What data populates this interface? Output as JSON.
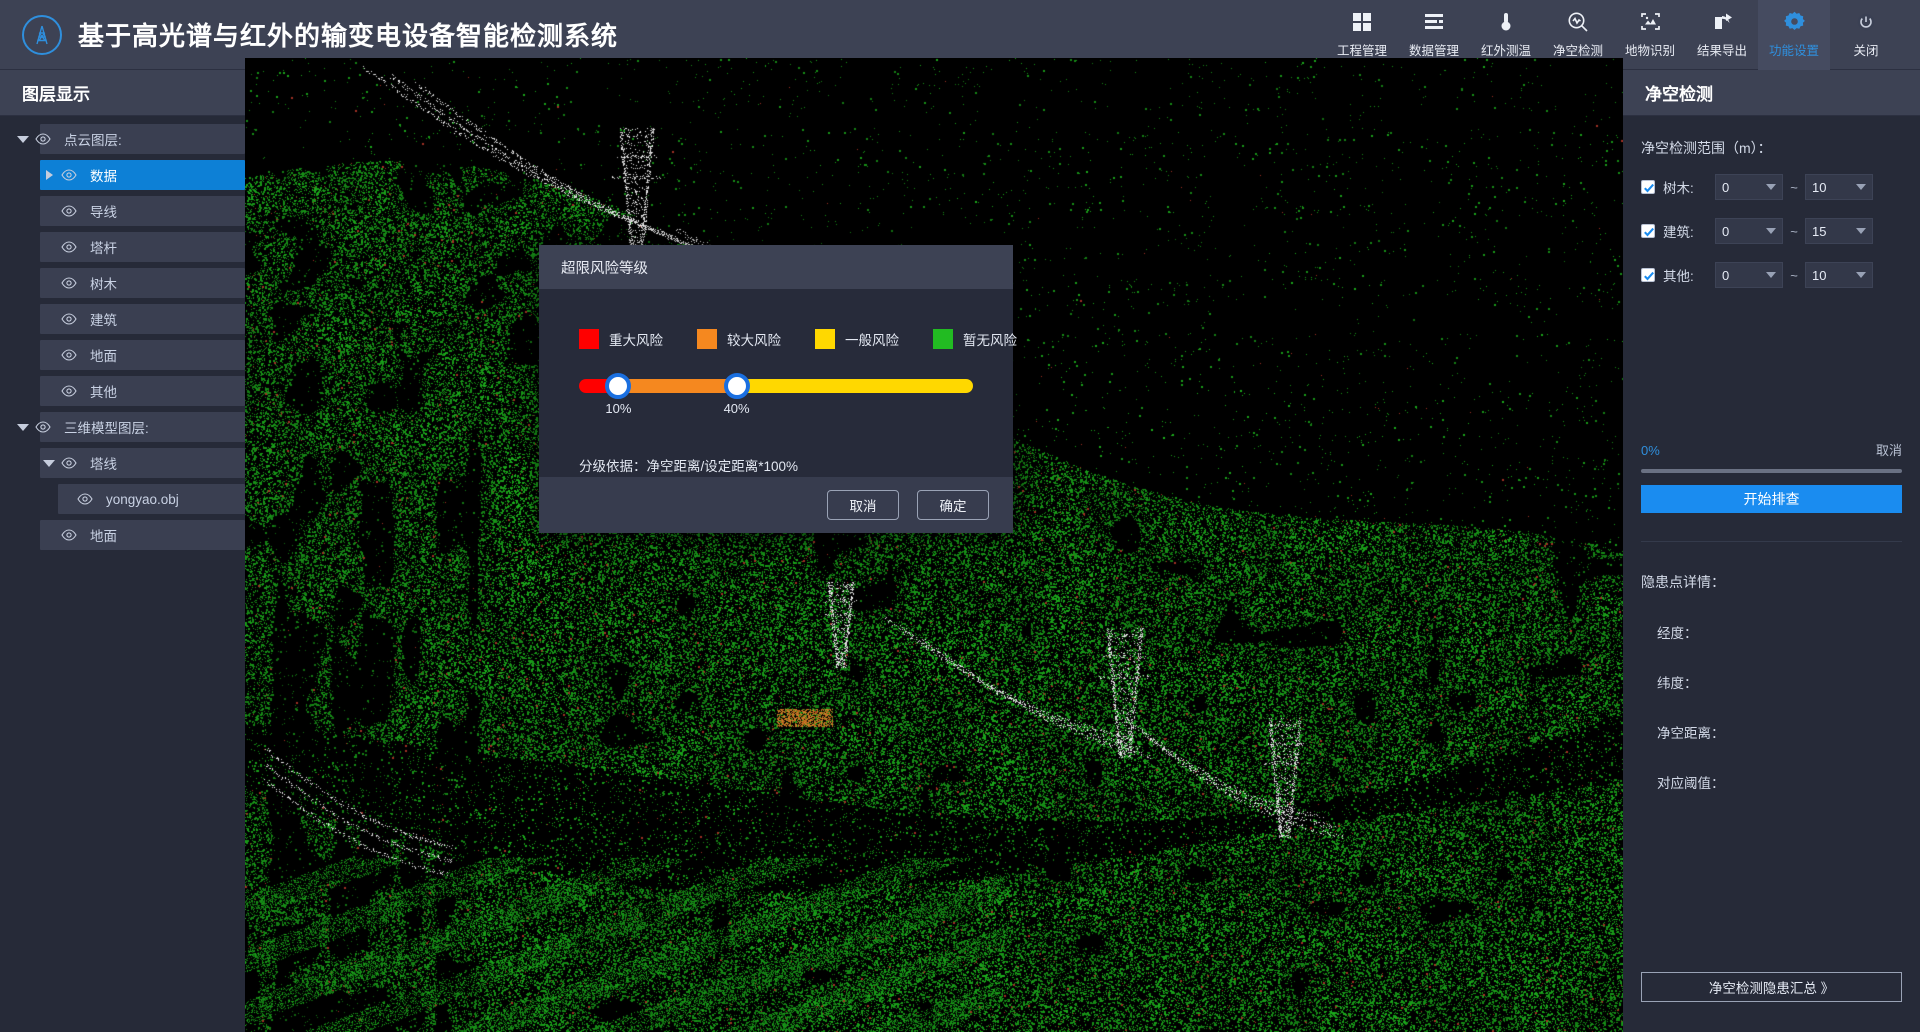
{
  "header": {
    "title": "基于高光谱与红外的输变电设备智能检测系统",
    "logo_icon": "transmission-tower-icon",
    "nav": [
      {
        "label": "工程管理",
        "icon": "grid-icon",
        "active": false
      },
      {
        "label": "数据管理",
        "icon": "database-icon",
        "active": false
      },
      {
        "label": "红外测温",
        "icon": "thermometer-icon",
        "active": false
      },
      {
        "label": "净空检测",
        "icon": "search-wave-icon",
        "active": false
      },
      {
        "label": "地物识别",
        "icon": "image-scan-icon",
        "active": false
      },
      {
        "label": "结果导出",
        "icon": "export-icon",
        "active": false
      },
      {
        "label": "功能设置",
        "icon": "gear-icon",
        "active": true
      },
      {
        "label": "关闭",
        "icon": "power-icon",
        "active": false
      }
    ]
  },
  "left_panel": {
    "title": "图层显示",
    "tree": [
      {
        "label": "点云图层:",
        "depth": 0,
        "caret": "down",
        "eye": true,
        "selected": false
      },
      {
        "label": "数据",
        "depth": 1,
        "caret": "right",
        "eye": true,
        "selected": true
      },
      {
        "label": "导线",
        "depth": 1,
        "caret": "none",
        "eye": true,
        "selected": false
      },
      {
        "label": "塔杆",
        "depth": 1,
        "caret": "none",
        "eye": true,
        "selected": false
      },
      {
        "label": "树木",
        "depth": 1,
        "caret": "none",
        "eye": true,
        "selected": false
      },
      {
        "label": "建筑",
        "depth": 1,
        "caret": "none",
        "eye": true,
        "selected": false
      },
      {
        "label": "地面",
        "depth": 1,
        "caret": "none",
        "eye": true,
        "selected": false
      },
      {
        "label": "其他",
        "depth": 1,
        "caret": "none",
        "eye": true,
        "selected": false
      },
      {
        "label": "三维模型图层:",
        "depth": 0,
        "caret": "down",
        "eye": true,
        "selected": false
      },
      {
        "label": "塔线",
        "depth": 1,
        "caret": "down",
        "eye": true,
        "selected": false
      },
      {
        "label": "yongyao.obj",
        "depth": 2,
        "caret": "none",
        "eye": true,
        "selected": false
      },
      {
        "label": "地面",
        "depth": 1,
        "caret": "none",
        "eye": true,
        "selected": false
      }
    ]
  },
  "right_panel": {
    "title": "净空检测",
    "range_title": "净空检测范围（m）：",
    "ranges": [
      {
        "label": "树木:",
        "checked": true,
        "min": "0",
        "max": "10"
      },
      {
        "label": "建筑:",
        "checked": true,
        "min": "0",
        "max": "15"
      },
      {
        "label": "其他:",
        "checked": true,
        "min": "0",
        "max": "10"
      }
    ],
    "tilde": "~",
    "progress_percent": "0%",
    "progress_value": 0,
    "cancel_label": "取消",
    "start_label": "开始排查",
    "detail_title": "隐患点详情：",
    "details": [
      {
        "label": "经度：",
        "value": ""
      },
      {
        "label": "纬度：",
        "value": ""
      },
      {
        "label": "净空距离：",
        "value": ""
      },
      {
        "label": "对应阈值：",
        "value": ""
      }
    ],
    "summary_button": "净空检测隐患汇总 》"
  },
  "modal": {
    "title": "超限风险等级",
    "legend": [
      {
        "label": "重大风险",
        "color": "#ff0000"
      },
      {
        "label": "较大风险",
        "color": "#f5881f"
      },
      {
        "label": "一般风险",
        "color": "#ffd800"
      },
      {
        "label": "暂无风险",
        "color": "#22bb22"
      }
    ],
    "slider": {
      "handles": [
        {
          "value": 10,
          "label": "10%"
        },
        {
          "value": 40,
          "label": "40%"
        }
      ],
      "segments": [
        {
          "color": "#ff0000",
          "from": 0,
          "to": 10
        },
        {
          "color": "#f5881f",
          "from": 10,
          "to": 40
        },
        {
          "color": "#ffd800",
          "from": 40,
          "to": 100
        }
      ],
      "handle_color": "#1a6fe0"
    },
    "basis_text": "分级依据：净空距离/设定距离*100%",
    "cancel_label": "取消",
    "confirm_label": "确定"
  },
  "viewport": {
    "name": "point-cloud-viewport",
    "background": "#000000",
    "point_colors": {
      "vegetation": "#22a522",
      "conductor": "#dcdcdc",
      "risk": "#c0392b"
    }
  }
}
